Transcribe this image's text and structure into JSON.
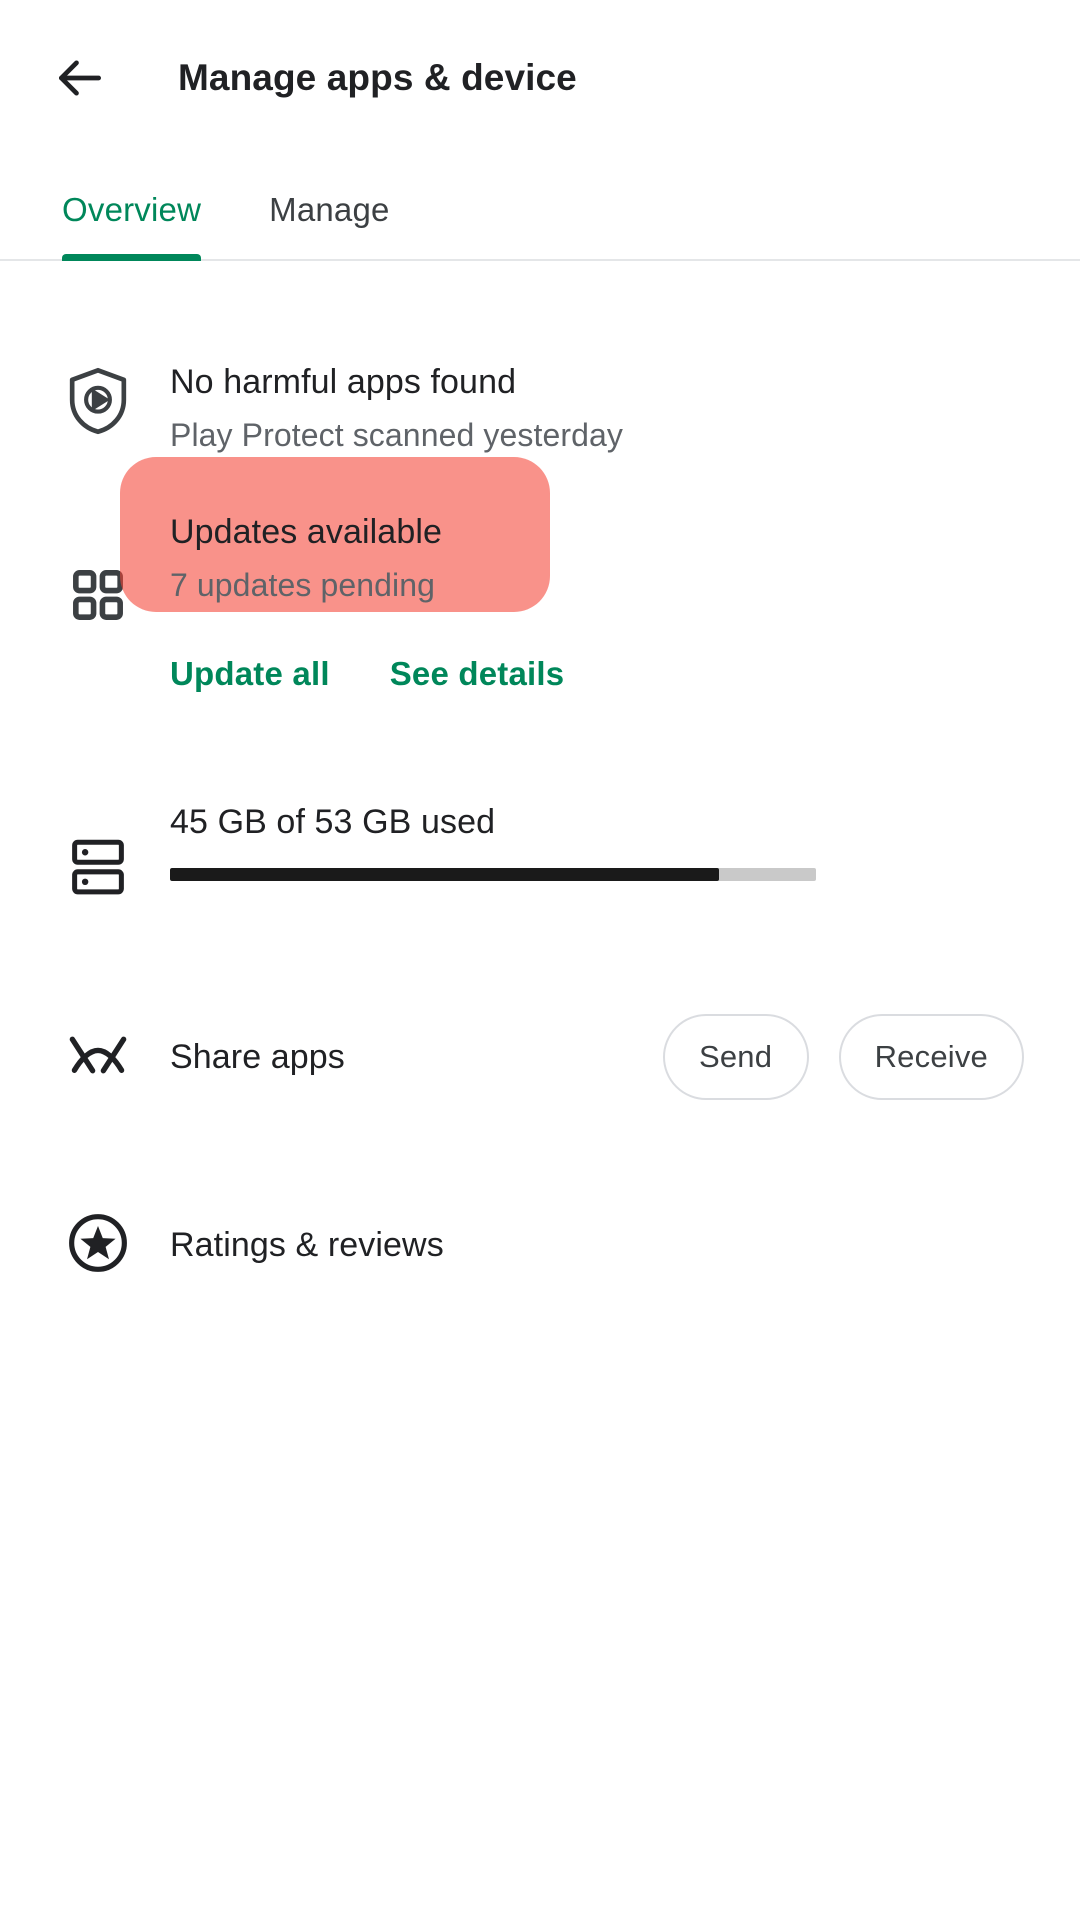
{
  "appbar": {
    "back_icon": "back-arrow-icon",
    "title": "Manage apps & device"
  },
  "tabs": [
    {
      "label": "Overview",
      "active": true
    },
    {
      "label": "Manage",
      "active": false
    }
  ],
  "colors": {
    "accent_green": "#00875a",
    "highlight_red": "#FB7B7B",
    "progress_fill": "#1a1a1a",
    "progress_track": "#c9c9c9",
    "text_primary": "#202124",
    "text_secondary": "#5f6368"
  },
  "sections": {
    "play_protect": {
      "icon": "play-protect-shield-icon",
      "title": "No harmful apps found",
      "subtitle": "Play Protect scanned yesterday"
    },
    "updates": {
      "icon": "apps-grid-icon",
      "title": "Updates available",
      "subtitle": "7 updates pending",
      "pending_count": "7",
      "highlighted": true,
      "actions": [
        {
          "label": "Update all"
        },
        {
          "label": "See details"
        }
      ]
    },
    "storage": {
      "icon": "storage-icon",
      "title": "45 GB of 53 GB used",
      "used_gb": "45",
      "total_gb": "53",
      "percent_used": "85"
    },
    "share": {
      "icon": "nearby-share-icon",
      "label": "Share apps",
      "buttons": [
        {
          "label": "Send"
        },
        {
          "label": "Receive"
        }
      ]
    },
    "ratings": {
      "icon": "star-circle-icon",
      "label": "Ratings & reviews"
    }
  }
}
